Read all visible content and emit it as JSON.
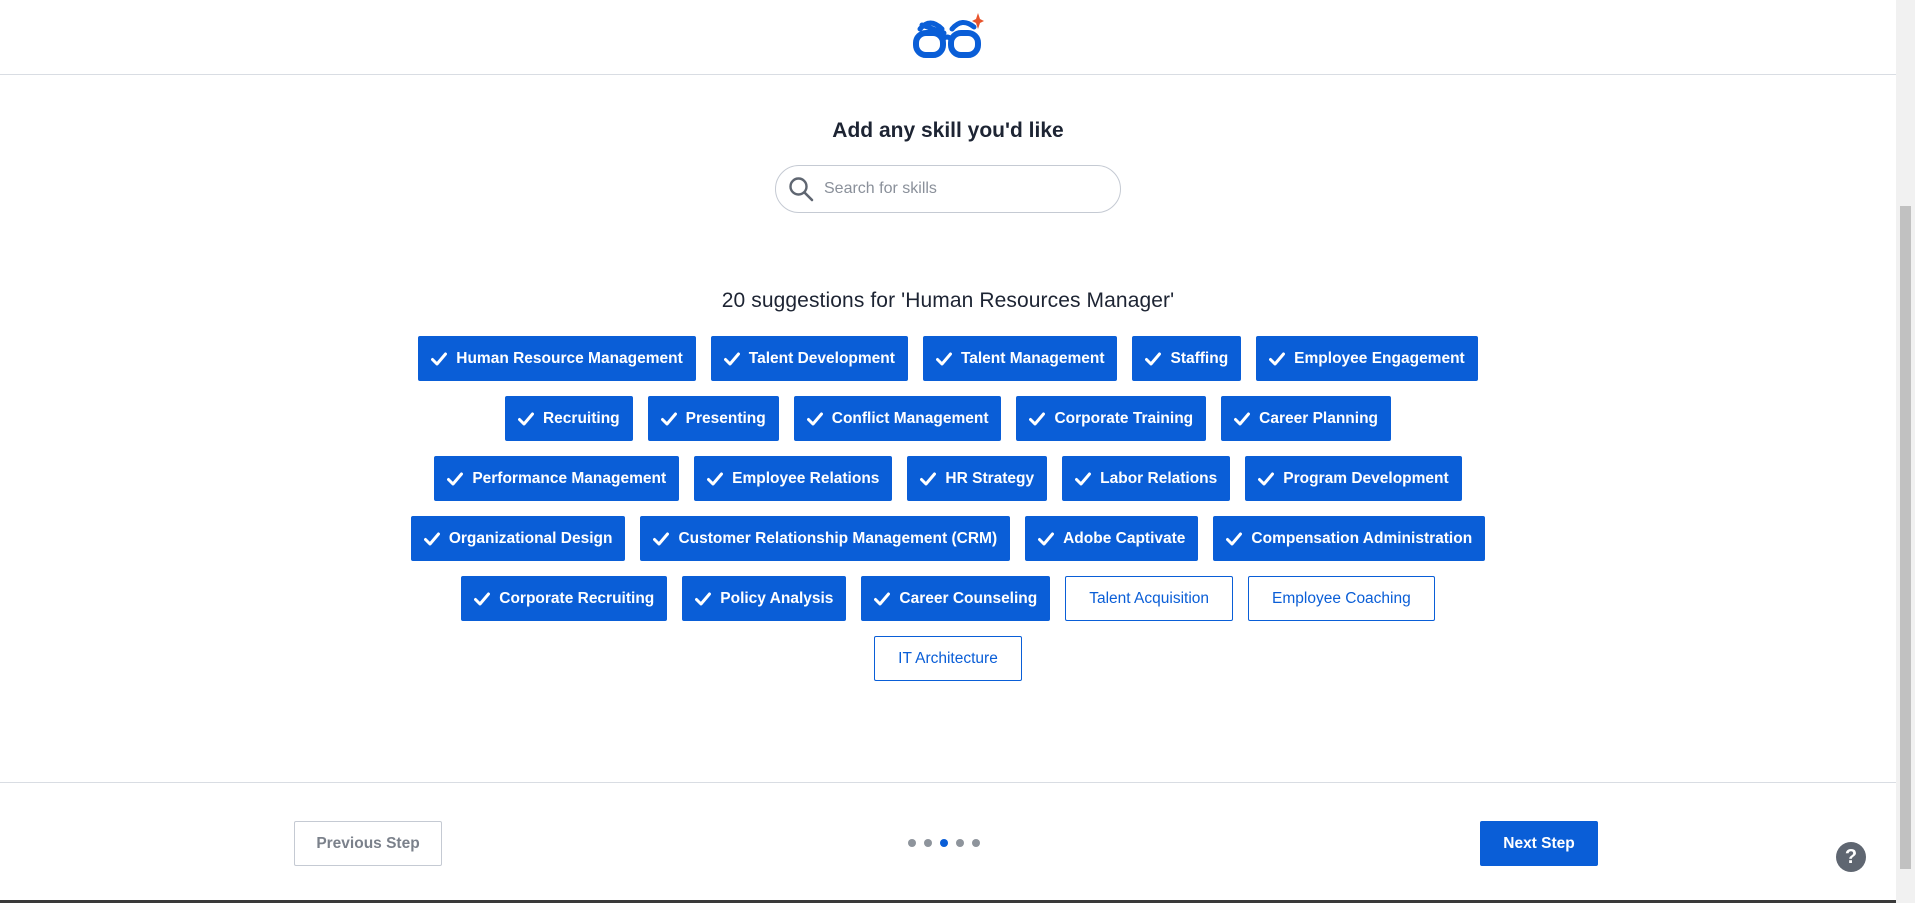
{
  "header": {
    "logo_icon": "glasses-logo-icon",
    "accent_color": "#0a5ed7",
    "logo_spark_color": "#e8542c"
  },
  "main": {
    "title": "Add any skill you'd like",
    "search": {
      "placeholder": "Search for skills",
      "value": ""
    },
    "suggestions_title": "20 suggestions for 'Human Resources Manager'",
    "skills": [
      {
        "label": "Human Resource Management",
        "selected": true
      },
      {
        "label": "Talent Development",
        "selected": true
      },
      {
        "label": "Talent Management",
        "selected": true
      },
      {
        "label": "Staffing",
        "selected": true
      },
      {
        "label": "Employee Engagement",
        "selected": true
      },
      {
        "label": "Recruiting",
        "selected": true
      },
      {
        "label": "Presenting",
        "selected": true
      },
      {
        "label": "Conflict Management",
        "selected": true
      },
      {
        "label": "Corporate Training",
        "selected": true
      },
      {
        "label": "Career Planning",
        "selected": true
      },
      {
        "label": "Performance Management",
        "selected": true
      },
      {
        "label": "Employee Relations",
        "selected": true
      },
      {
        "label": "HR Strategy",
        "selected": true
      },
      {
        "label": "Labor Relations",
        "selected": true
      },
      {
        "label": "Program Development",
        "selected": true
      },
      {
        "label": "Organizational Design",
        "selected": true
      },
      {
        "label": "Customer Relationship Management (CRM)",
        "selected": true
      },
      {
        "label": "Adobe Captivate",
        "selected": true
      },
      {
        "label": "Compensation Administration",
        "selected": true
      },
      {
        "label": "Corporate Recruiting",
        "selected": true
      },
      {
        "label": "Policy Analysis",
        "selected": true
      },
      {
        "label": "Career Counseling",
        "selected": true
      },
      {
        "label": "Talent Acquisition",
        "selected": false
      },
      {
        "label": "Employee Coaching",
        "selected": false
      },
      {
        "label": "IT Architecture",
        "selected": false
      }
    ]
  },
  "footer": {
    "previous_label": "Previous Step",
    "next_label": "Next Step",
    "step_count": 5,
    "current_step": 3,
    "help_label": "?"
  }
}
